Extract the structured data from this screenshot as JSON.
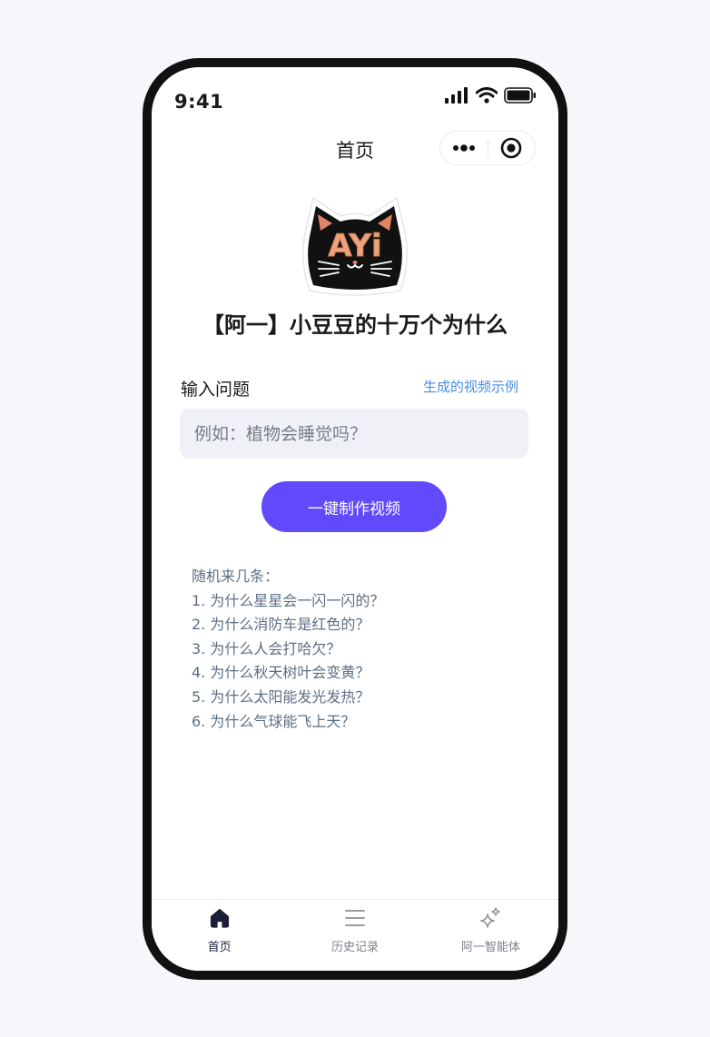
{
  "status_bar": {
    "time": "9:41"
  },
  "nav": {
    "title": "首页"
  },
  "app": {
    "logo_text": "AYi",
    "title": "【阿一】小豆豆的十万个为什么"
  },
  "form": {
    "label": "输入问题",
    "example_link": "生成的视频示例",
    "placeholder": "例如：植物会睡觉吗？",
    "value": "",
    "submit_label": "一键制作视频"
  },
  "random": {
    "heading": "随机来几条：",
    "items": [
      "1. 为什么星星会一闪一闪的？",
      "2. 为什么消防车是红色的？",
      "3. 为什么人会打哈欠？",
      "4. 为什么秋天树叶会变黄？",
      "5. 为什么太阳能发光发热？",
      "6. 为什么气球能飞上天？"
    ]
  },
  "tabbar": {
    "tabs": [
      {
        "label": "首页",
        "icon": "home-icon",
        "active": true
      },
      {
        "label": "历史记录",
        "icon": "list-icon",
        "active": false
      },
      {
        "label": "阿一智能体",
        "icon": "sparkle-icon",
        "active": false
      }
    ]
  },
  "colors": {
    "accent": "#6149fc",
    "link": "#4a8de0",
    "input_bg": "#eff1f7",
    "muted_text": "#5e6f84"
  }
}
